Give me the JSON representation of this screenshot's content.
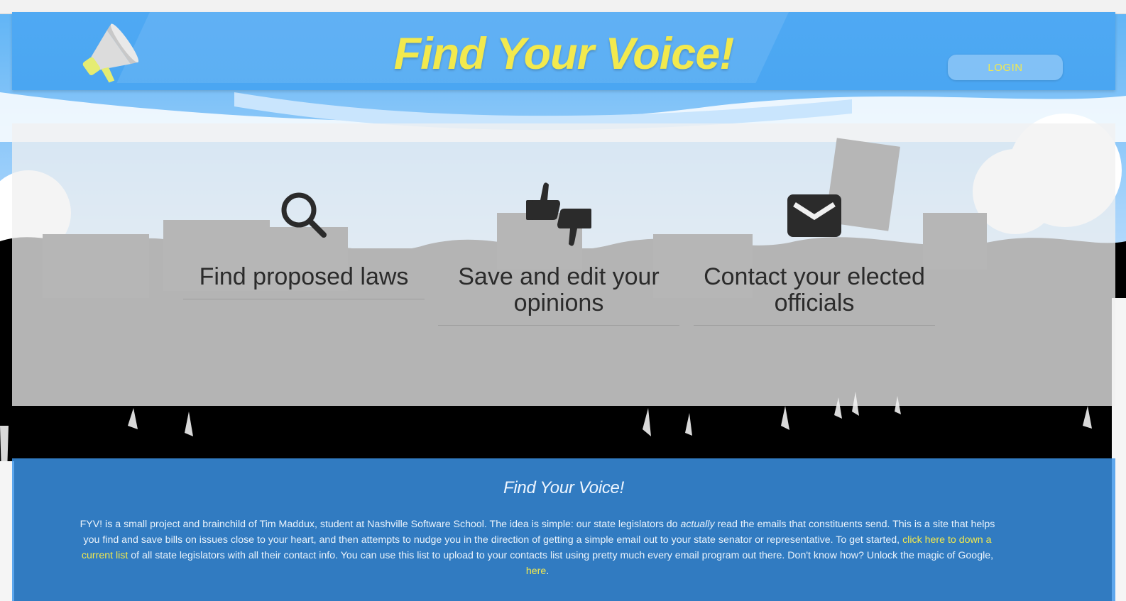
{
  "header": {
    "title": "Find Your Voice!",
    "login_label": "LOGIN",
    "logo_icon": "megaphone-icon"
  },
  "features": [
    {
      "icon": "search-icon",
      "label": "Find proposed laws"
    },
    {
      "icon": "thumbs-up-down-icon",
      "label": "Save and edit your opinions"
    },
    {
      "icon": "envelope-icon",
      "label": "Contact your elected officials"
    }
  ],
  "footer": {
    "title": "Find Your Voice!",
    "text_1": "FYV! is a small project and brainchild of Tim Maddux, student at Nashville Software School. The idea is simple: our state legislators do ",
    "text_emphasis": "actually",
    "text_2": " read the emails that constituents send. This is a site that helps you find and save bills on issues close to your heart, and then attempts to nudge you in the direction of getting a simple email out to your state senator or representative. To get started, ",
    "link_list": "click here to down a current list",
    "text_3": " of all state legislators with all their contact info. You can use this list to upload to your contacts list using pretty much every email program out there. Don't know how? Unlock the magic of Google, ",
    "link_google": "here",
    "text_4": "."
  },
  "colors": {
    "accent_yellow": "#f2e94e",
    "header_blue": "#4aa6f2",
    "footer_blue": "#3c96eb",
    "icon_dark": "#2b2b2b"
  }
}
